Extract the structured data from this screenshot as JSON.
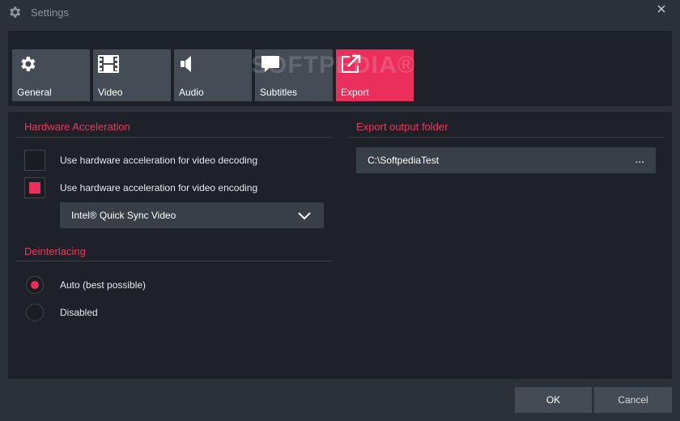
{
  "window": {
    "title": "Settings",
    "title_icon": "gear-icon",
    "close_glyph": "✕"
  },
  "tabs": [
    {
      "label": "General",
      "icon": "gear-icon",
      "active": false
    },
    {
      "label": "Video",
      "icon": "film-icon",
      "active": false
    },
    {
      "label": "Audio",
      "icon": "speaker-icon",
      "active": false
    },
    {
      "label": "Subtitles",
      "icon": "speech-bubble-icon",
      "active": false
    },
    {
      "label": "Export",
      "icon": "export-icon",
      "active": true
    }
  ],
  "watermark": "SOFTPEDIA®",
  "hardware_acceleration": {
    "title": "Hardware Acceleration",
    "decoding": {
      "label": "Use hardware acceleration for video decoding",
      "checked": false
    },
    "encoding": {
      "label": "Use hardware acceleration for video encoding",
      "checked": true
    },
    "encoder_select": {
      "value": "Intel® Quick Sync Video"
    }
  },
  "deinterlacing": {
    "title": "Deinterlacing",
    "options": [
      {
        "label": "Auto (best possible)",
        "selected": true
      },
      {
        "label": "Disabled",
        "selected": false
      }
    ]
  },
  "export_folder": {
    "title": "Export output folder",
    "path": "C:\\SoftpediaTest",
    "browse_label": "..."
  },
  "buttons": {
    "ok": "OK",
    "cancel": "Cancel"
  },
  "colors": {
    "accent": "#ea2f5c",
    "window_bg": "#2b3039",
    "panel_bg": "#1e2228",
    "tab_bg": "#464c55",
    "field_bg": "#393f47"
  }
}
